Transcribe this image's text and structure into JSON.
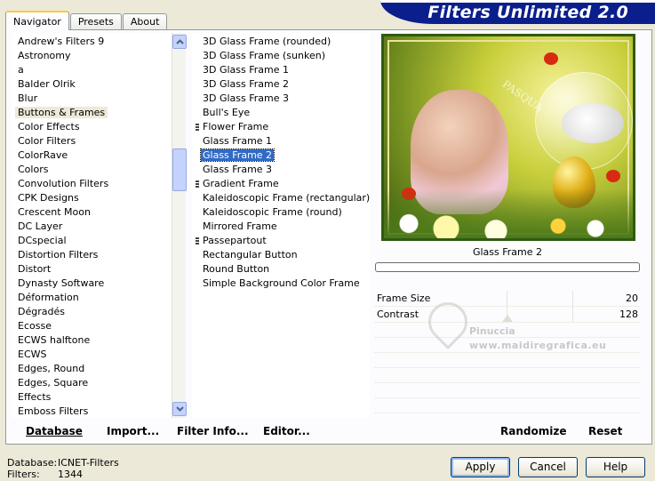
{
  "tabs": [
    "Navigator",
    "Presets",
    "About"
  ],
  "banner_title": "Filters Unlimited 2.0",
  "categories": [
    "Andrew's Filters 9",
    "Astronomy",
    "a",
    "Balder Olrik",
    "Blur",
    "Buttons & Frames",
    "Color Effects",
    "Color Filters",
    "ColorRave",
    "Colors",
    "Convolution Filters",
    "CPK Designs",
    "Crescent Moon",
    "DC Layer",
    "DCspecial",
    "Distortion Filters",
    "Distort",
    "Dynasty Software",
    "Déformation",
    "Dégradés",
    "Ecosse",
    "ECWS halftone",
    "ECWS",
    "Edges, Round",
    "Edges, Square",
    "Effects",
    "Emboss Filters"
  ],
  "selected_category": "Buttons & Frames",
  "filters": [
    {
      "label": "3D Glass Frame (rounded)",
      "group": false
    },
    {
      "label": "3D Glass Frame (sunken)",
      "group": false
    },
    {
      "label": "3D Glass Frame 1",
      "group": false
    },
    {
      "label": "3D Glass Frame 2",
      "group": false
    },
    {
      "label": "3D Glass Frame 3",
      "group": false
    },
    {
      "label": "Bull's Eye",
      "group": false
    },
    {
      "label": "Flower Frame",
      "group": true
    },
    {
      "label": "Glass Frame 1",
      "group": false
    },
    {
      "label": "Glass Frame 2",
      "group": false
    },
    {
      "label": "Glass Frame 3",
      "group": false
    },
    {
      "label": "Gradient Frame",
      "group": true
    },
    {
      "label": "Kaleidoscopic Frame (rectangular)",
      "group": false
    },
    {
      "label": "Kaleidoscopic Frame (round)",
      "group": false
    },
    {
      "label": "Mirrored Frame",
      "group": false
    },
    {
      "label": "Passepartout",
      "group": true
    },
    {
      "label": "Rectangular Button",
      "group": false
    },
    {
      "label": "Round Button",
      "group": false
    },
    {
      "label": "Simple Background Color Frame",
      "group": false
    }
  ],
  "selected_filter": "Glass Frame 2",
  "preview": {
    "filter_name": "Glass Frame 2",
    "signature": "PASQUA"
  },
  "params": [
    {
      "label": "Frame Size",
      "value": "20"
    },
    {
      "label": "Contrast",
      "value": "128"
    }
  ],
  "watermark": {
    "line1": "Pinuccia",
    "line2": "www.maidiregrafica.eu"
  },
  "toolbar": {
    "database": "Database",
    "import": "Import...",
    "filter_info": "Filter Info...",
    "editor": "Editor...",
    "randomize": "Randomize",
    "reset": "Reset"
  },
  "status": {
    "database_label": "Database:",
    "database_value": "ICNET-Filters",
    "filters_label": "Filters:",
    "filters_value": "1344"
  },
  "buttons": {
    "apply": "Apply",
    "cancel": "Cancel",
    "help": "Help"
  }
}
